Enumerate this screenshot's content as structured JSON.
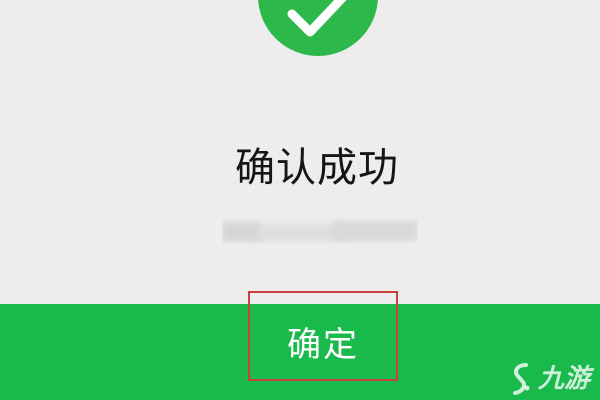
{
  "dialog": {
    "title": "确认成功",
    "status_icon": "check-circle-icon",
    "confirm_label": "确定"
  },
  "colors": {
    "background": "#EDEDED",
    "success_green": "#2DB84C",
    "bar_green": "#19B94B",
    "highlight_red": "#C9403A",
    "title_text": "#151515"
  },
  "watermark": {
    "text": "九游",
    "icon": "jiuyou-logo-icon"
  }
}
